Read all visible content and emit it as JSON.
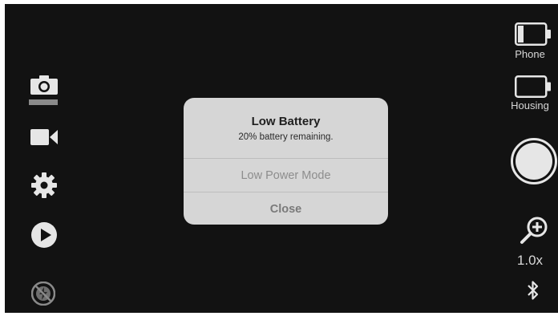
{
  "left_toolbar": {
    "items": [
      {
        "name": "camera-icon",
        "mode": "photo",
        "selected": true
      },
      {
        "name": "video-camera-icon",
        "mode": "video"
      },
      {
        "name": "gear-icon",
        "mode": "settings"
      },
      {
        "name": "play-icon",
        "mode": "playback"
      },
      {
        "name": "no-flash-icon",
        "mode": "disabled"
      }
    ]
  },
  "right_bar": {
    "phone_battery": {
      "label": "Phone",
      "level": 0.2
    },
    "housing_battery": {
      "label": "Housing",
      "level": 0.0
    },
    "zoom": {
      "icon": "zoom-in-icon",
      "value": "1.0x"
    },
    "bluetooth_icon": "bluetooth-icon"
  },
  "alert": {
    "title": "Low Battery",
    "message": "20% battery remaining.",
    "buttons": {
      "low_power_mode": "Low Power Mode",
      "close": "Close"
    }
  },
  "colors": {
    "background": "#121212",
    "dialog": "#d6d6d6",
    "icon": "#e6e6e6"
  }
}
